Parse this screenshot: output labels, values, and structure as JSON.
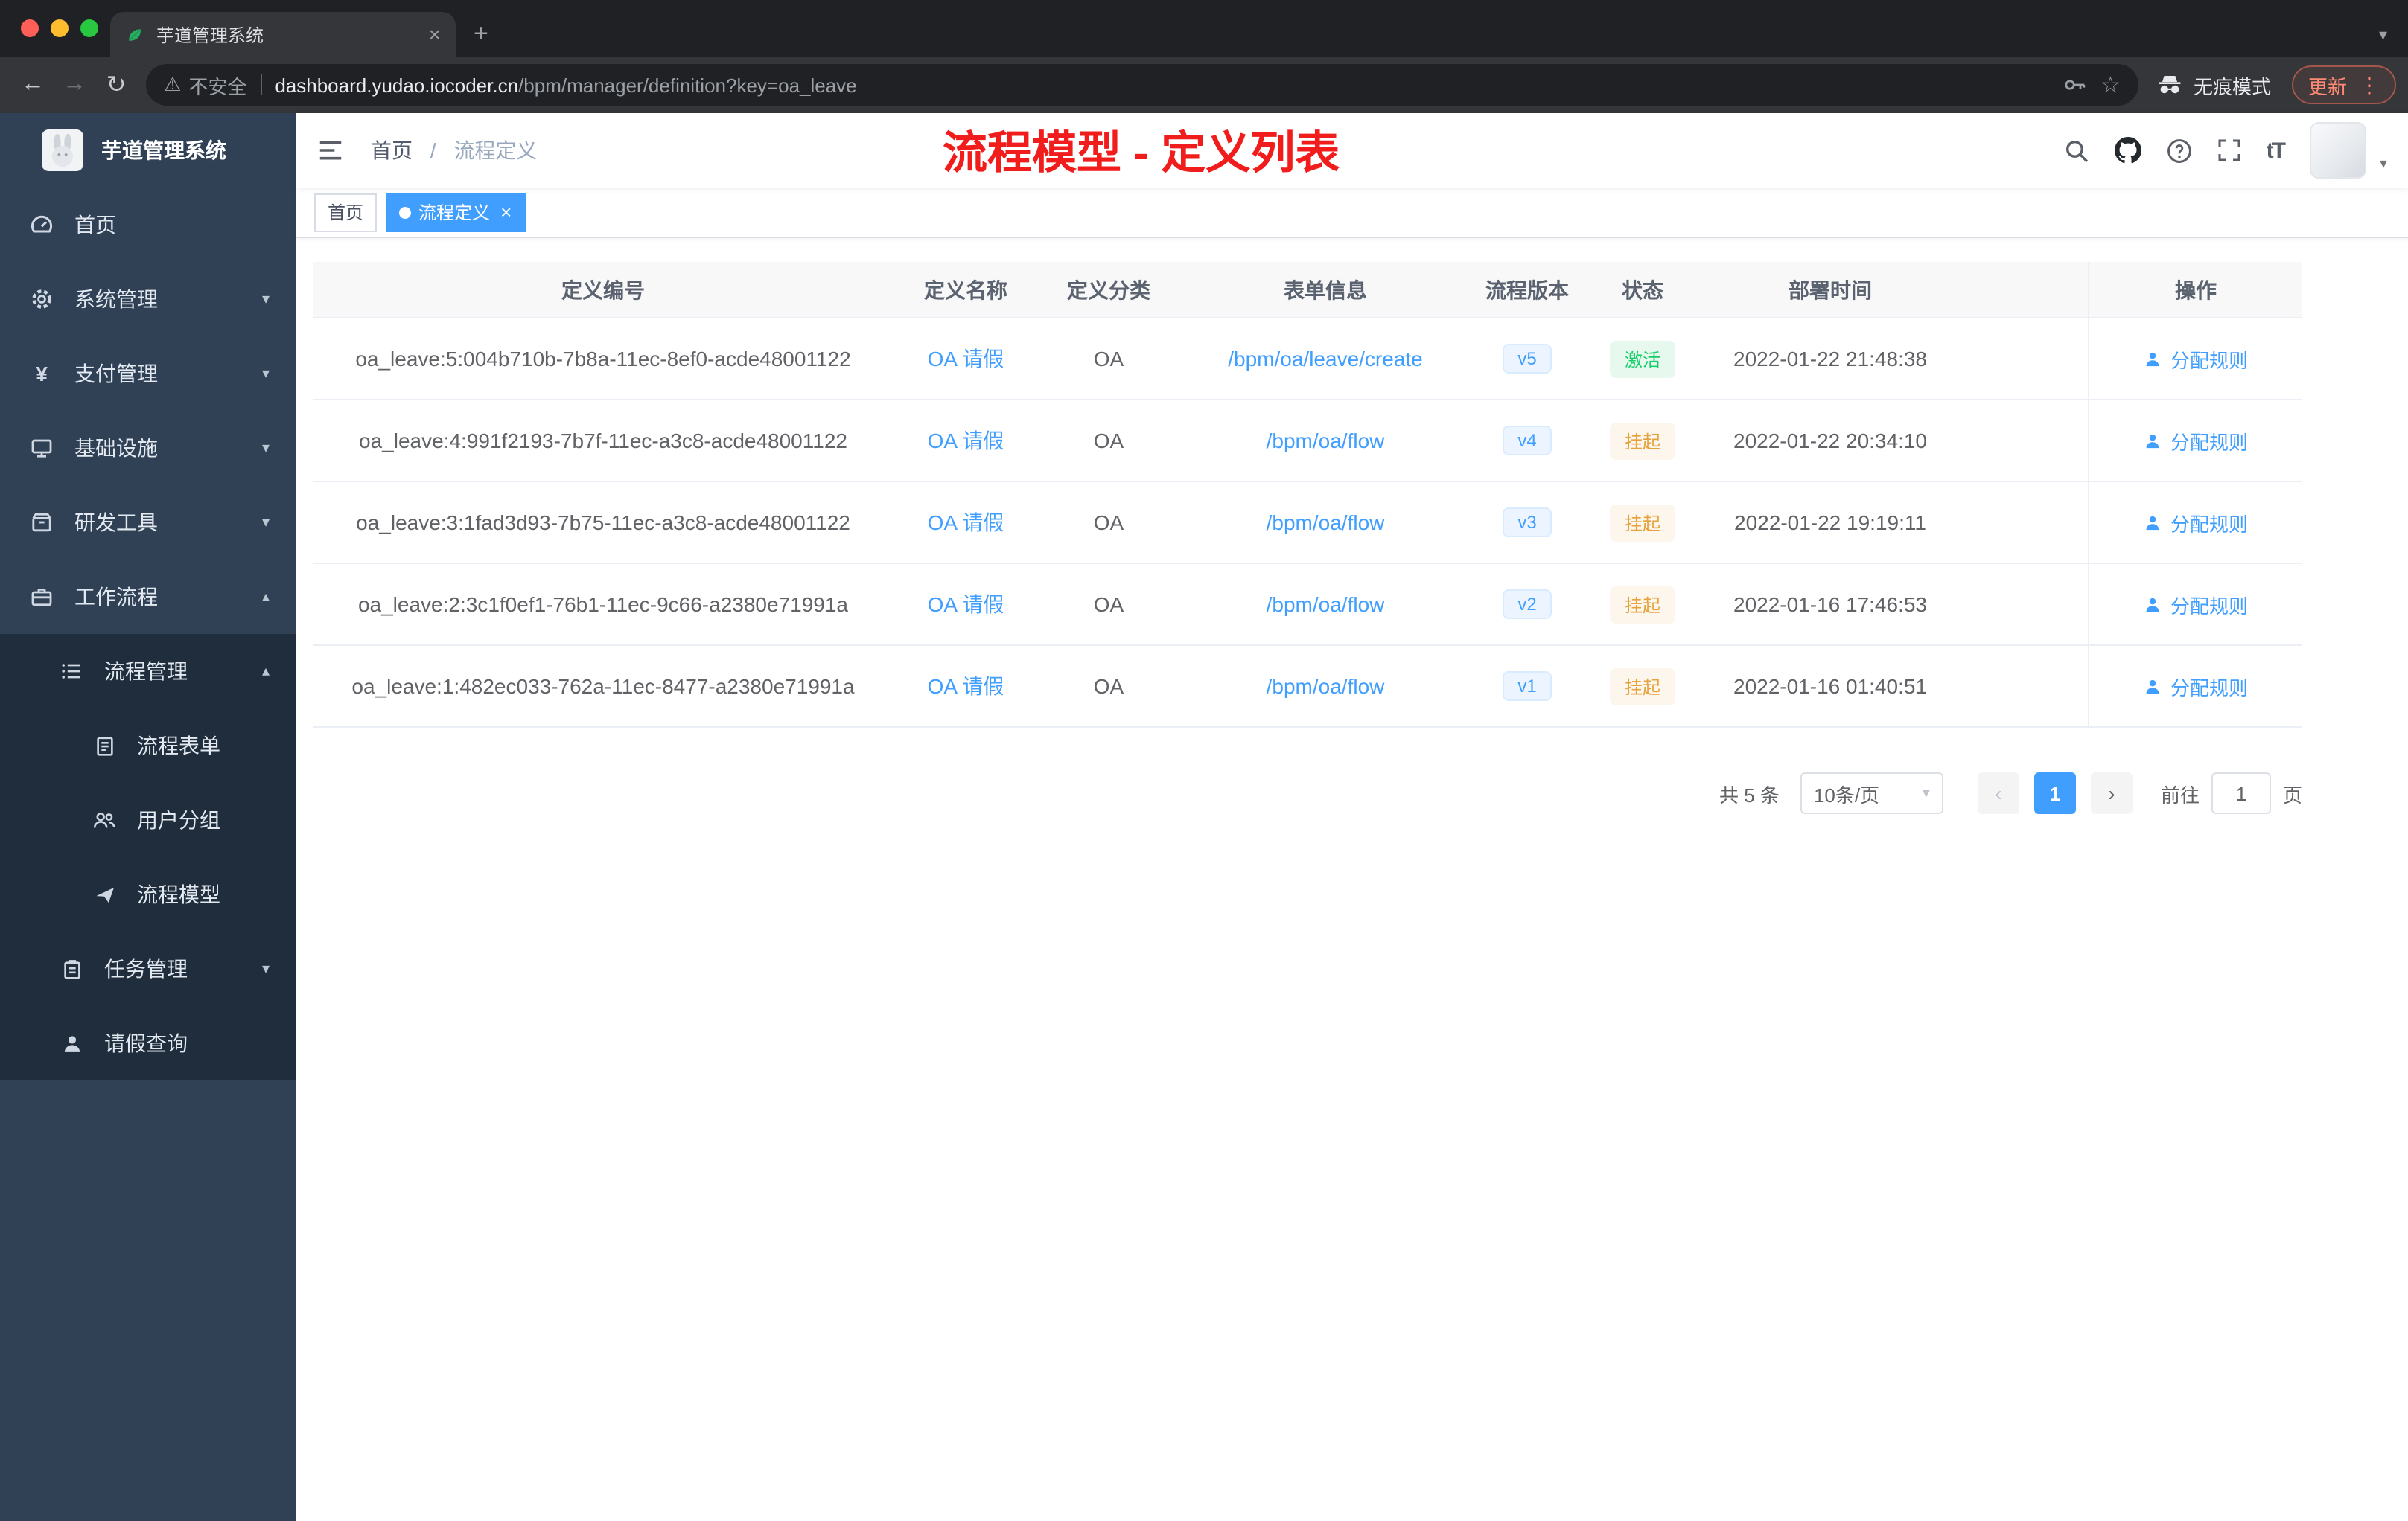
{
  "icons": {
    "close": "×",
    "plus": "+",
    "caret_down": "▾",
    "caret_up": "▴",
    "back": "←",
    "forward": "→",
    "refresh": "↻",
    "warning": "⚠",
    "star": "☆",
    "kebab": "⋮",
    "prev": "‹",
    "next": "›",
    "font_size": "tT"
  },
  "browser": {
    "tab_title": "芋道管理系统",
    "security_label": "不安全",
    "url_host": "dashboard.yudao.iocoder.cn",
    "url_path": "/bpm/manager/definition?key=oa_leave",
    "incognito_label": "无痕模式",
    "update_label": "更新"
  },
  "sidebar": {
    "logo_title": "芋道管理系统",
    "items": [
      {
        "label": "首页",
        "arrow": ""
      },
      {
        "label": "系统管理",
        "arrow": "▾"
      },
      {
        "label": "支付管理",
        "arrow": "▾"
      },
      {
        "label": "基础设施",
        "arrow": "▾"
      },
      {
        "label": "研发工具",
        "arrow": "▾"
      },
      {
        "label": "工作流程",
        "arrow": "▴"
      },
      {
        "label": "流程管理",
        "arrow": "▴"
      },
      {
        "label": "流程表单",
        "arrow": ""
      },
      {
        "label": "用户分组",
        "arrow": ""
      },
      {
        "label": "流程模型",
        "arrow": ""
      },
      {
        "label": "任务管理",
        "arrow": "▾"
      },
      {
        "label": "请假查询",
        "arrow": ""
      }
    ]
  },
  "navbar": {
    "breadcrumb_home": "首页",
    "breadcrumb_sep": "/",
    "breadcrumb_current": "流程定义",
    "annotation_title": "流程模型 - 定义列表"
  },
  "tags": {
    "home": "首页",
    "active": "流程定义"
  },
  "table": {
    "headers": {
      "id": "定义编号",
      "name": "定义名称",
      "category": "定义分类",
      "form": "表单信息",
      "version": "流程版本",
      "status": "状态",
      "time": "部署时间",
      "action": "操作"
    },
    "rows": [
      {
        "id": "oa_leave:5:004b710b-7b8a-11ec-8ef0-acde48001122",
        "name": "OA 请假",
        "category": "OA",
        "form": "/bpm/oa/leave/create",
        "version": "v5",
        "status": "激活",
        "time": "2022-01-22 21:48:38",
        "action": "分配规则"
      },
      {
        "id": "oa_leave:4:991f2193-7b7f-11ec-a3c8-acde48001122",
        "name": "OA 请假",
        "category": "OA",
        "form": "/bpm/oa/flow",
        "version": "v4",
        "status": "挂起",
        "time": "2022-01-22 20:34:10",
        "action": "分配规则"
      },
      {
        "id": "oa_leave:3:1fad3d93-7b75-11ec-a3c8-acde48001122",
        "name": "OA 请假",
        "category": "OA",
        "form": "/bpm/oa/flow",
        "version": "v3",
        "status": "挂起",
        "time": "2022-01-22 19:19:11",
        "action": "分配规则"
      },
      {
        "id": "oa_leave:2:3c1f0ef1-76b1-11ec-9c66-a2380e71991a",
        "name": "OA 请假",
        "category": "OA",
        "form": "/bpm/oa/flow",
        "version": "v2",
        "status": "挂起",
        "time": "2022-01-16 17:46:53",
        "action": "分配规则"
      },
      {
        "id": "oa_leave:1:482ec033-762a-11ec-8477-a2380e71991a",
        "name": "OA 请假",
        "category": "OA",
        "form": "/bpm/oa/flow",
        "version": "v1",
        "status": "挂起",
        "time": "2022-01-16 01:40:51",
        "action": "分配规则"
      }
    ]
  },
  "pagination": {
    "total": "共 5 条",
    "page_size": "10条/页",
    "current_page": "1",
    "goto_label": "前往",
    "goto_value": "1",
    "page_unit": "页"
  },
  "colors": {
    "accent_blue": "#409eff",
    "success_green": "#13ce66",
    "warning_orange": "#e6a23c",
    "annotation_red": "#f11c1c",
    "sidebar_bg": "#304156",
    "sidebar_sub_bg": "#1f2d3d"
  }
}
